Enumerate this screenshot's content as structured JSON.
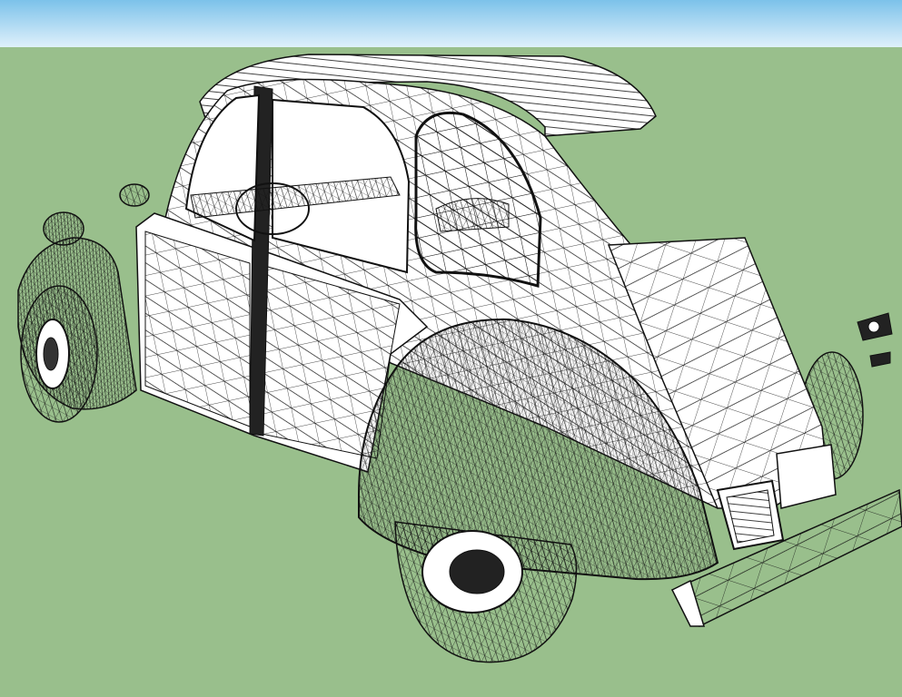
{
  "viewport": {
    "sky_top_color": "#7cc2ea",
    "sky_bottom_color": "#dff0fb",
    "ground_color": "#99bf8c",
    "line_color": "#111111",
    "surface_color": "#ffffff",
    "shadow_color": "#d9d9d9"
  },
  "model": {
    "subject": "car-wireframe-model",
    "render_style": "wireframe"
  }
}
